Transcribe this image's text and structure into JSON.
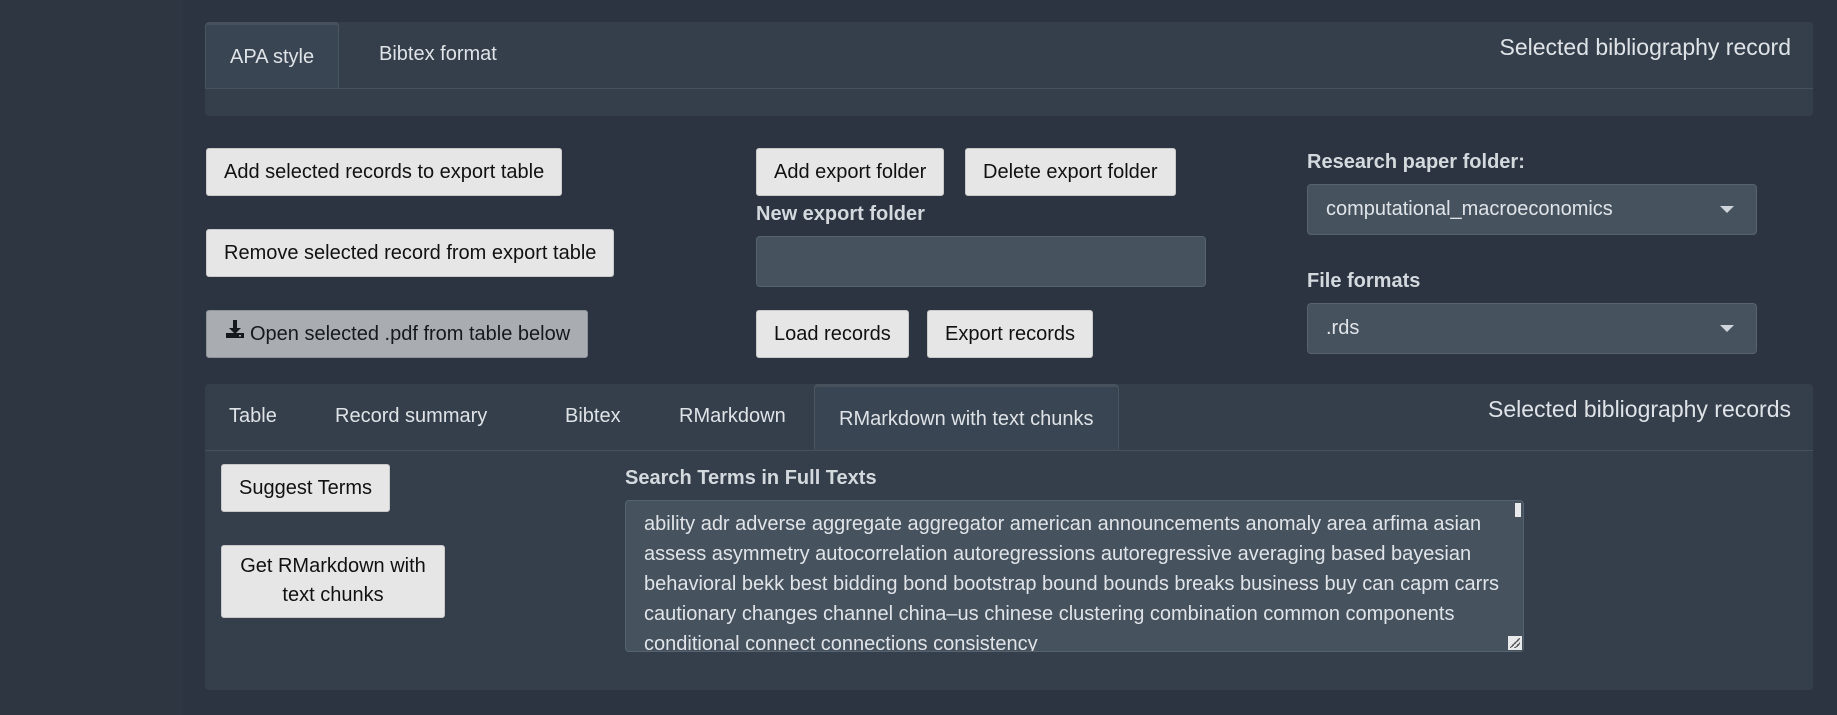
{
  "top_panel": {
    "tabs": [
      "APA style",
      "Bibtex format"
    ],
    "active_tab": "APA style",
    "title": "Selected bibliography record"
  },
  "controls": {
    "add_records_button": "Add selected records to export table",
    "remove_record_button": "Remove selected record from export table",
    "open_pdf_button": "Open selected .pdf from table below",
    "add_folder_button": "Add export folder",
    "delete_folder_button": "Delete export folder",
    "new_folder_label": "New export folder",
    "new_folder_value": "",
    "load_records_button": "Load records",
    "export_records_button": "Export records",
    "research_folder_label": "Research paper folder:",
    "research_folder_value": "computational_macroeconomics",
    "file_formats_label": "File formats",
    "file_formats_value": ".rds"
  },
  "bottom_panel": {
    "tabs": [
      "Table",
      "Record summary",
      "Bibtex",
      "RMarkdown",
      "RMarkdown with text chunks"
    ],
    "active_tab": "RMarkdown with text chunks",
    "title": "Selected bibliography records",
    "suggest_terms_button": "Suggest Terms",
    "get_rmarkdown_button": "Get RMarkdown with text chunks",
    "search_terms_label": "Search Terms in Full Texts",
    "search_terms_value": "ability adr adverse aggregate aggregator american announcements anomaly area arfima asian assess asymmetry autocorrelation autoregressions autoregressive averaging based bayesian behavioral bekk best bidding bond bootstrap bound bounds breaks business buy can capm carrs cautionary changes channel china–us chinese clustering combination common components conditional connect connections consistency"
  },
  "icons": {
    "download": "download-icon"
  }
}
